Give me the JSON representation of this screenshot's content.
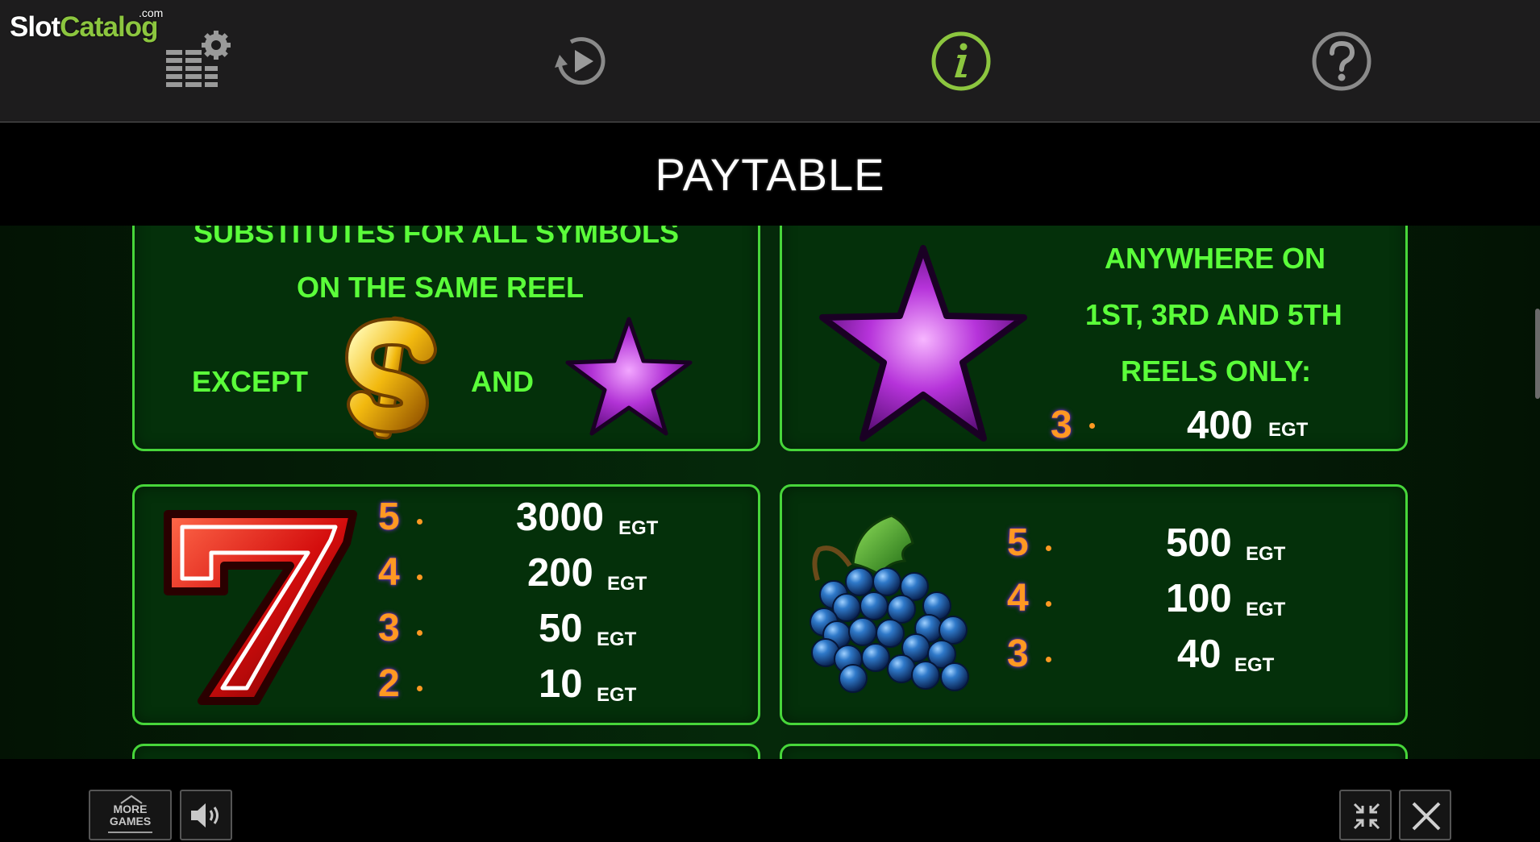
{
  "brand": {
    "main": "Slot",
    "accent": "Catalog",
    "suffix": ".com"
  },
  "toolbar": {
    "icons": [
      "settings-icon",
      "autoplay-icon",
      "info-icon",
      "help-icon"
    ],
    "active": "info-icon",
    "accent_color": "#8cc63f"
  },
  "title": "PAYTABLE",
  "cards": {
    "wild": {
      "line1": "SUBSTITUTES FOR ALL SYMBOLS",
      "line2": "ON THE SAME REEL",
      "except": "EXCEPT",
      "and": "AND"
    },
    "scatter": {
      "line1": "ANYWHERE ON",
      "line2": "1ST, 3RD AND 5TH",
      "line3": "REELS ONLY:",
      "rows": [
        {
          "count": "3",
          "value": "400",
          "unit": "EGT"
        }
      ]
    },
    "seven": {
      "rows": [
        {
          "count": "5",
          "value": "3000",
          "unit": "EGT"
        },
        {
          "count": "4",
          "value": "200",
          "unit": "EGT"
        },
        {
          "count": "3",
          "value": "50",
          "unit": "EGT"
        },
        {
          "count": "2",
          "value": "10",
          "unit": "EGT"
        }
      ]
    },
    "grapes": {
      "rows": [
        {
          "count": "5",
          "value": "500",
          "unit": "EGT"
        },
        {
          "count": "4",
          "value": "100",
          "unit": "EGT"
        },
        {
          "count": "3",
          "value": "40",
          "unit": "EGT"
        }
      ]
    }
  },
  "bottom": {
    "more_games_line1": "MORE",
    "more_games_line2": "GAMES"
  },
  "colors": {
    "text_green": "#5bff3a",
    "border_green": "#47d63a",
    "count_orange": "#ff9922"
  }
}
